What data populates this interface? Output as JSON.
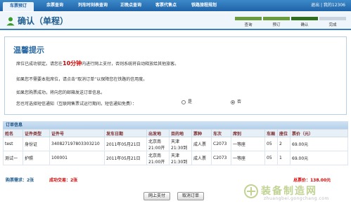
{
  "nav": {
    "tabs": [
      {
        "label": "车票预订",
        "active": true
      },
      {
        "label": "余票查询",
        "active": false
      },
      {
        "label": "列车时刻表查询",
        "active": false
      },
      {
        "label": "正晚点查询",
        "active": false
      },
      {
        "label": "客票代售点",
        "active": false
      },
      {
        "label": "铁路旅程规划",
        "active": false
      }
    ],
    "user": "退出 | 我的12306"
  },
  "page": {
    "title": "确认（单程）",
    "icon": "person-icon",
    "steps": [
      {
        "label": "查询",
        "state": "done"
      },
      {
        "label": "预订",
        "state": "done"
      },
      {
        "label": "确认",
        "state": "current"
      },
      {
        "label": "完成",
        "state": "pending"
      }
    ]
  },
  "notice": {
    "title": "温馨提示",
    "line1_pre": "席位已成功锁定。请您在",
    "line1_highlight": "10分钟",
    "line1_post": "内进行网上支付，否则系统将自动释放给其他旅客。",
    "line2": "如果您不需要本批席位，请点击“取消订单”以保障您在铁路的信用度。",
    "line3": "如果您购票成功，将向您的邮箱发送订单信息。",
    "sms_question": "您也可选择短信通知（互联网售票试运行期间，短信通知免费）：",
    "sms_options": [
      {
        "label": "是",
        "checked": false
      },
      {
        "label": "否",
        "checked": true
      }
    ]
  },
  "orders": {
    "header": "订单信息",
    "columns": [
      "姓名",
      "证件类型",
      "证件号",
      "发车日期",
      "出发地",
      "目的地",
      "票种",
      "车次",
      "席别",
      "车厢",
      "座位",
      "票价（元）"
    ],
    "rows": [
      {
        "name": "test",
        "id_type": "身份证",
        "id_no": "340827197803303210",
        "date": "2011年05月21日",
        "from_city": "北京南",
        "from_time": "21:00开",
        "to_city": "天津",
        "to_time": "21:30到",
        "ticket_type": "成人票",
        "train": "C2073",
        "seat_class": "一等座",
        "car": "05",
        "seat": "2",
        "price": "69.00元"
      },
      {
        "name": "测试一",
        "id_type": "护照",
        "id_no": "100001",
        "date": "2011年05月21日",
        "from_city": "北京南",
        "from_time": "21:00开",
        "to_city": "天津",
        "to_time": "21:30到",
        "ticket_type": "成人票",
        "train": "C2073",
        "seat_class": "一等座",
        "car": "05",
        "seat": "1",
        "price": "69.00元"
      }
    ],
    "tickets_label": "购票需求：2张",
    "success_label": "成功交易：2张",
    "total_label": "总票价：138.00元"
  },
  "buttons": {
    "pay": "网上支付",
    "cancel": "取消订单"
  },
  "watermark": {
    "main": "装备制造网",
    "sub": "zhuangbei.gongchang.com"
  },
  "colors": {
    "nav_bg": "#1f63a8",
    "title_text": "#1f5d8f",
    "highlight_red": "#d40000",
    "step_done": "#6a9b3c"
  }
}
